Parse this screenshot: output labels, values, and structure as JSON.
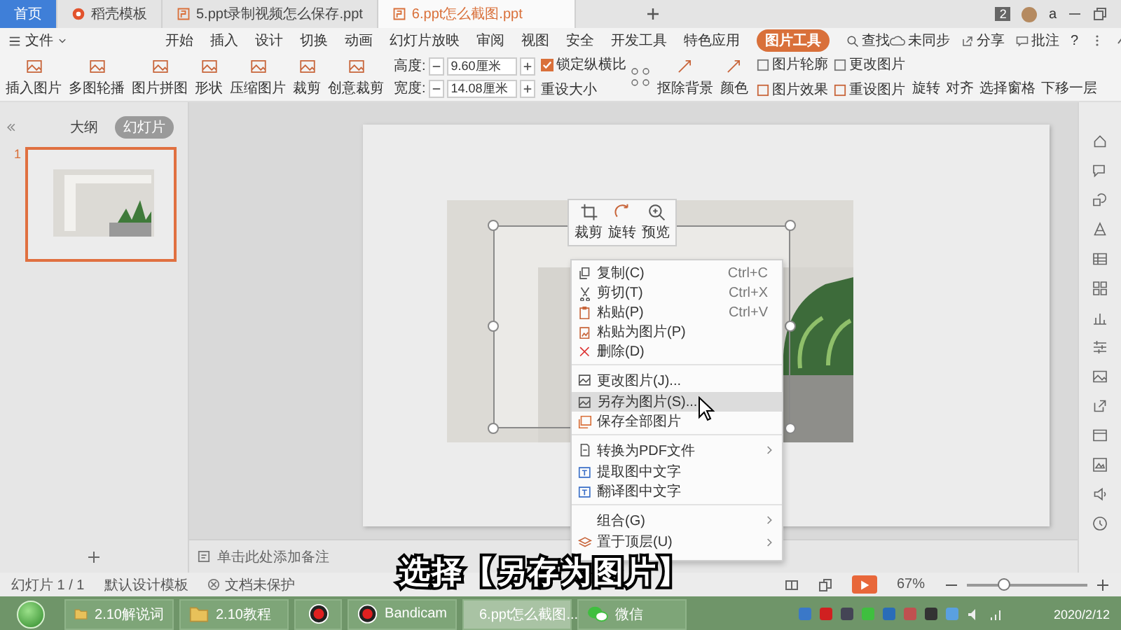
{
  "title_bar": {
    "tabs": [
      {
        "label": "首页",
        "kind": "home",
        "selected": false
      },
      {
        "label": "稻壳模板",
        "kind": "docer",
        "selected": false
      },
      {
        "label": "5.ppt录制视频怎么保存.ppt",
        "kind": "ppt",
        "selected": false
      },
      {
        "label": "6.ppt怎么截图.ppt",
        "kind": "ppt",
        "selected": true
      }
    ],
    "badge": "2",
    "user": "a"
  },
  "menu_bar": {
    "file": "文件",
    "tabs": [
      {
        "label": "开始",
        "selected": false
      },
      {
        "label": "插入",
        "selected": false
      },
      {
        "label": "设计",
        "selected": false
      },
      {
        "label": "切换",
        "selected": false
      },
      {
        "label": "动画",
        "selected": false
      },
      {
        "label": "幻灯片放映",
        "selected": false
      },
      {
        "label": "审阅",
        "selected": false
      },
      {
        "label": "视图",
        "selected": false
      },
      {
        "label": "安全",
        "selected": false
      },
      {
        "label": "开发工具",
        "selected": false
      },
      {
        "label": "特色应用",
        "selected": false
      },
      {
        "label": "图片工具",
        "selected": true
      }
    ],
    "search": "查找",
    "sync": "未同步",
    "share": "分享",
    "comment": "批注",
    "help": "?"
  },
  "ribbon": {
    "big": [
      {
        "label": "插入图片"
      },
      {
        "label": "多图轮播"
      },
      {
        "label": "图片拼图"
      },
      {
        "label": "形状"
      },
      {
        "label": "压缩图片"
      },
      {
        "label": "裁剪"
      },
      {
        "label": "创意裁剪"
      }
    ],
    "size": [
      {
        "label": "高度:",
        "value": "9.60厘米"
      },
      {
        "label": "宽度:",
        "value": "14.08厘米"
      }
    ],
    "lock_ratio": {
      "label": "锁定纵横比",
      "checked": true
    },
    "reset_size": "重设大小",
    "tools": [
      {
        "label": "抠除背景"
      },
      {
        "label": "颜色"
      }
    ],
    "picture_columns": [
      {
        "top": "图片轮廓",
        "bottom": "图片效果"
      },
      {
        "top": "更改图片",
        "bottom": "重设图片"
      }
    ],
    "arrange": [
      "旋转",
      "对齐",
      "选择窗格",
      "下移一层"
    ]
  },
  "slide_panel": {
    "tabs": [
      {
        "label": "大纲",
        "selected": false
      },
      {
        "label": "幻灯片",
        "selected": true
      }
    ],
    "slides": [
      {
        "number": "1",
        "selected": true
      }
    ]
  },
  "mini_toolbar": [
    {
      "label": "裁剪",
      "kind": "crop"
    },
    {
      "label": "旋转",
      "kind": "rotate"
    },
    {
      "label": "预览",
      "kind": "zoom"
    }
  ],
  "context_menu": [
    {
      "label": "复制(C)",
      "shortcut": "Ctrl+C",
      "kind": "copy",
      "selected": false,
      "divider": false,
      "submenu": false
    },
    {
      "label": "剪切(T)",
      "shortcut": "Ctrl+X",
      "kind": "cut",
      "selected": false,
      "divider": false,
      "submenu": false
    },
    {
      "label": "粘贴(P)",
      "shortcut": "Ctrl+V",
      "kind": "paste",
      "selected": false,
      "divider": false,
      "submenu": false
    },
    {
      "label": "粘贴为图片(P)",
      "kind": "paste_image",
      "selected": false,
      "divider": false,
      "submenu": false
    },
    {
      "label": "删除(D)",
      "kind": "delete",
      "selected": false,
      "divider": false,
      "submenu": false
    },
    {
      "label": "更改图片(J)...",
      "kind": "image",
      "selected": false,
      "divider": true,
      "submenu": false
    },
    {
      "label": "另存为图片(S)...",
      "kind": "image",
      "selected": true,
      "divider": false,
      "submenu": false
    },
    {
      "label": "保存全部图片",
      "kind": "images",
      "selected": false,
      "divider": false,
      "submenu": false
    },
    {
      "label": "转换为PDF文件",
      "kind": "pdf",
      "selected": false,
      "divider": true,
      "submenu": true
    },
    {
      "label": "提取图中文字",
      "kind": "text",
      "selected": false,
      "divider": false,
      "submenu": false
    },
    {
      "label": "翻译图中文字",
      "kind": "text",
      "selected": false,
      "divider": false,
      "submenu": false
    },
    {
      "label": "组合(G)",
      "kind": "none",
      "selected": false,
      "divider": true,
      "submenu": true
    },
    {
      "label": "置于顶层(U)",
      "kind": "layers",
      "selected": false,
      "divider": false,
      "submenu": true
    }
  ],
  "notes": {
    "text": "单击此处添加备注"
  },
  "status_bar": {
    "slide": "幻灯片 1 / 1",
    "template": "默认设计模板",
    "protection": "文档未保护",
    "zoom": "67%",
    "zoom_slider": {
      "level": 0.3
    }
  },
  "taskbar": {
    "items": [
      {
        "label": "2.10解说词",
        "kind": "folder",
        "selected": false
      },
      {
        "label": "2.10教程",
        "kind": "folder",
        "selected": false
      },
      {
        "kind": "record",
        "selected": false
      },
      {
        "label": "Bandicam",
        "kind": "record",
        "selected": false
      },
      {
        "label": "6.ppt怎么截图...",
        "kind": "wps",
        "selected": true
      },
      {
        "label": "微信",
        "kind": "chat",
        "selected": false
      }
    ],
    "date": "2020/2/12"
  },
  "caption": "选择【另存为图片】"
}
